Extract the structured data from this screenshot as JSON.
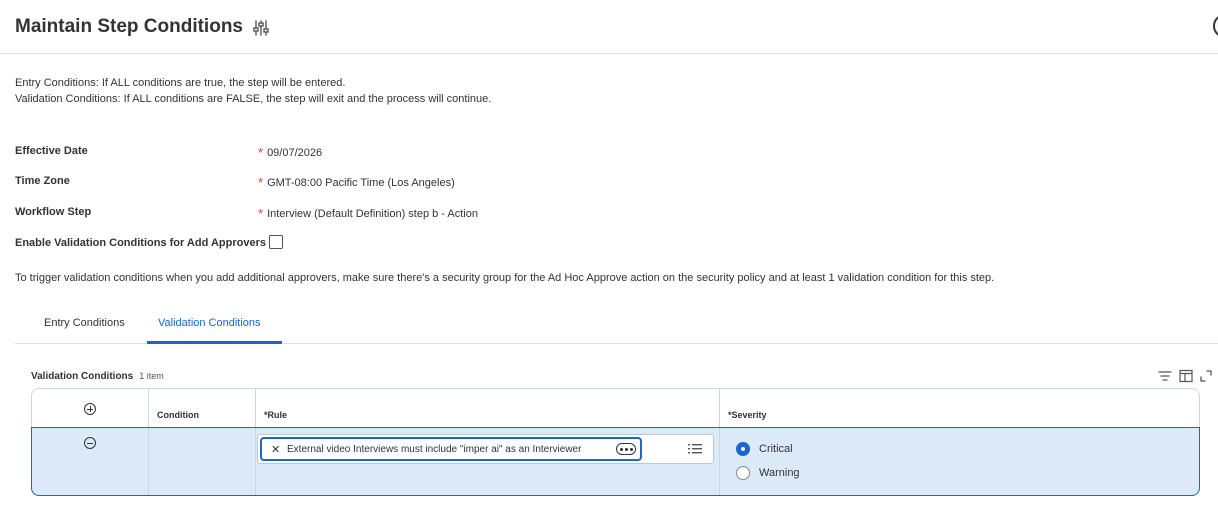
{
  "header": {
    "title": "Maintain Step Conditions",
    "related_actions_icon": "sliders-icon"
  },
  "info": {
    "entry_line": "Entry Conditions: If ALL conditions are true, the step will be entered.",
    "validation_line": "Validation Conditions: If ALL conditions are FALSE, the step will exit and the process will continue."
  },
  "fields": {
    "effective_date": {
      "label": "Effective Date",
      "required": "*",
      "value": "09/07/2026"
    },
    "time_zone": {
      "label": "Time Zone",
      "required": "*",
      "value": "GMT-08:00 Pacific Time (Los Angeles)"
    },
    "workflow_step": {
      "label": "Workflow Step",
      "required": "*",
      "value": "Interview (Default Definition) step b - Action"
    },
    "enable_validation": {
      "label": "Enable Validation Conditions for Add Approvers",
      "checked": false
    }
  },
  "trigger_note": "To trigger validation conditions when you add additional approvers, make sure there's a security group for the Ad Hoc Approve action on the security policy and at least 1 validation condition for this step.",
  "tabs": [
    {
      "label": "Entry Conditions",
      "active": false
    },
    {
      "label": "Validation Conditions",
      "active": true
    }
  ],
  "grid": {
    "title": "Validation Conditions",
    "count": "1 item",
    "tools": [
      "filter-icon",
      "columns-icon",
      "expand-icon"
    ],
    "columns": [
      "Condition",
      "*Rule",
      "*Severity"
    ],
    "rows": [
      {
        "rule": "External video Interviews must include \"imper ai\" as an Interviewer",
        "severity_options": [
          "Critical",
          "Warning"
        ],
        "severity_selected": "Critical"
      }
    ]
  },
  "colors": {
    "accent": "#1a66c9",
    "required": "#de4531",
    "selected_row": "#dbe9f9"
  }
}
